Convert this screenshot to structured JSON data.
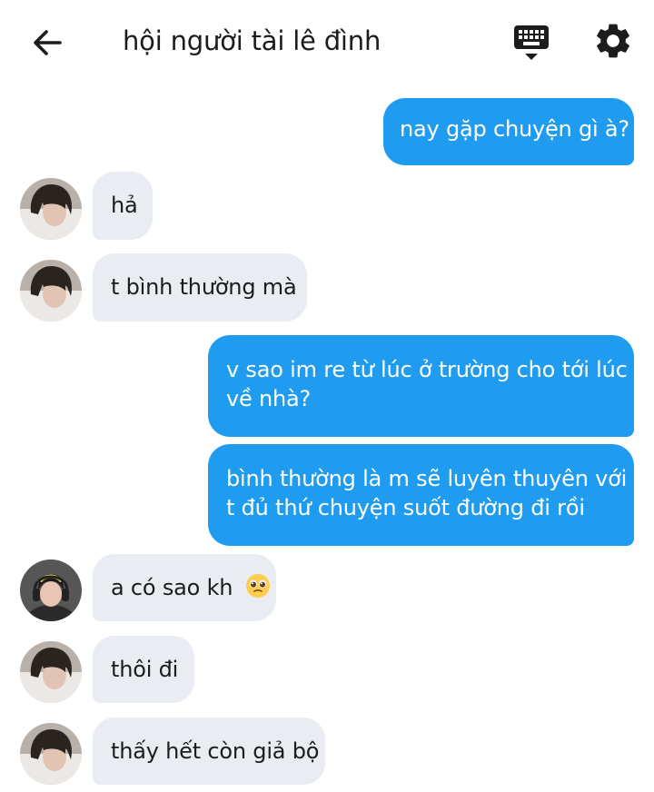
{
  "header": {
    "title": "hội người tài lê đình",
    "back_icon": "arrow-left-icon",
    "keyboard_icon": "keyboard-icon",
    "settings_icon": "gear-icon"
  },
  "colors": {
    "outgoing_bubble": "#1f9cf0",
    "incoming_bubble": "#e9edf1"
  },
  "messages": [
    {
      "side": "out",
      "lines": [
        "nay gặp chuyện gì à?"
      ]
    },
    {
      "side": "in",
      "avatar": "avatar-a",
      "lines": [
        "hả"
      ]
    },
    {
      "side": "in",
      "avatar": "avatar-a",
      "lines": [
        "t bình thường mà"
      ]
    },
    {
      "side": "out",
      "lines": [
        "v sao im re từ lúc ở trường cho tới lúc",
        "về nhà?"
      ]
    },
    {
      "side": "out",
      "lines": [
        "bình thường là m sẽ luyên thuyên với",
        "t đủ thứ chuyện suốt đường đi rồi"
      ]
    },
    {
      "side": "in",
      "avatar": "avatar-b",
      "lines": [
        "a có sao kh"
      ],
      "emoji": "🥺"
    },
    {
      "side": "in",
      "avatar": "avatar-a",
      "lines": [
        "thôi đi"
      ]
    },
    {
      "side": "in",
      "avatar": "avatar-a",
      "lines": [
        "thấy hết còn giả bộ"
      ]
    }
  ]
}
